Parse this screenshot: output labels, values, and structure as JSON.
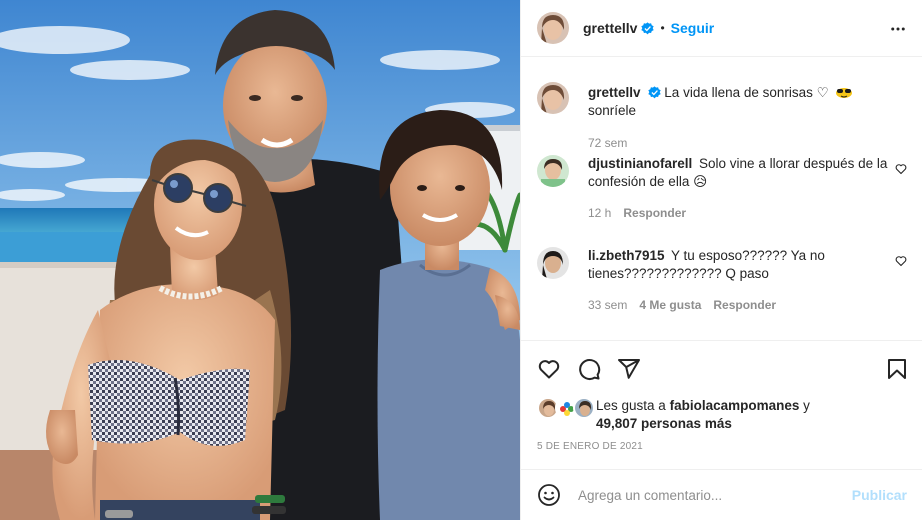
{
  "post": {
    "author": "grettellv",
    "follow_label": "Seguir",
    "separator": "•",
    "caption": "La vida llena de sonrisas ♡",
    "caption_tail": "sonríele",
    "caption_age": "72 sem",
    "date": "5 DE ENERO DE 2021"
  },
  "comments": [
    {
      "user": "djustinianofarell",
      "text": "Solo vine a llorar después de la confesión de ella 😥",
      "age": "12 h",
      "reply_label": "Responder"
    },
    {
      "user": "li.zbeth7915",
      "text": "Y tu esposo?????? Ya no tienes????????????? Q paso",
      "age": "33 sem",
      "likes": "4 Me gusta",
      "reply_label": "Responder"
    }
  ],
  "likes": {
    "prefix": "Les gusta a",
    "user": "fabiolacampomanes",
    "conj": "y",
    "count": "49,807 personas más"
  },
  "composer": {
    "placeholder": "Agrega un comentario...",
    "publish_label": "Publicar"
  },
  "icons": {
    "verified": "verified-badge-icon",
    "more": "more-options-icon",
    "heart": "heart-icon",
    "comment": "comment-icon",
    "share": "share-icon",
    "save": "bookmark-icon",
    "emoji": "emoji-icon"
  },
  "colors": {
    "accent": "#0095f6",
    "publish_disabled": "#b2dffc",
    "muted": "#8e8e8e",
    "text": "#262626"
  }
}
